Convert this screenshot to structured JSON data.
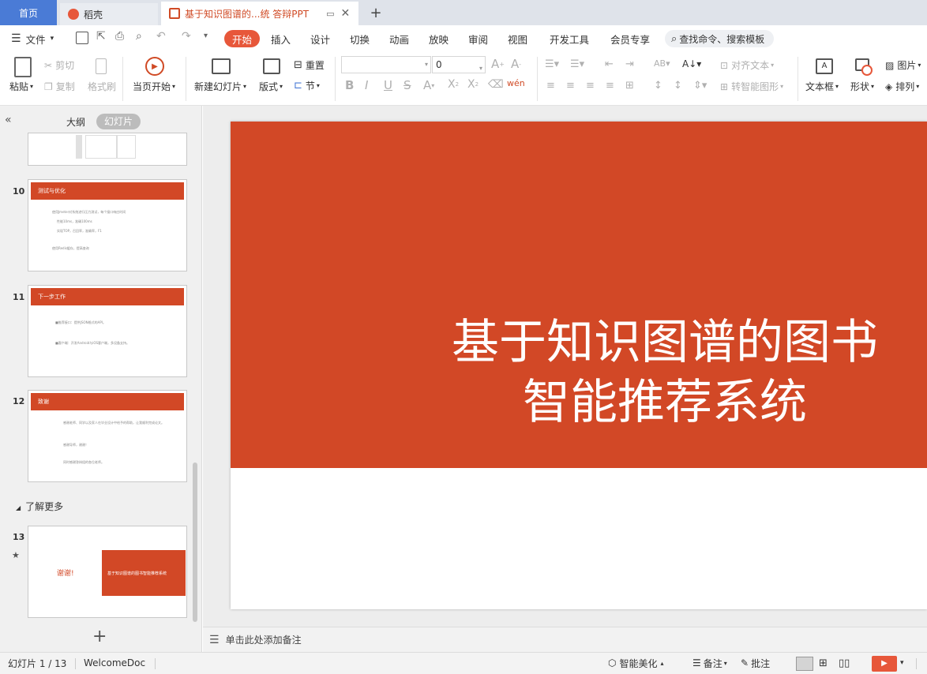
{
  "tabs": {
    "home": "首页",
    "doc": "稻壳",
    "active": "基于知识图谱的...统 答辩PPT"
  },
  "menu": [
    "文件",
    "开始",
    "插入",
    "设计",
    "切换",
    "动画",
    "放映",
    "审阅",
    "视图",
    "开发工具",
    "会员专享"
  ],
  "search_placeholder": "查找命令、搜索模板",
  "ribbon": {
    "paste": "粘贴",
    "cut": "剪切",
    "copy": "复制",
    "format_painter": "格式刷",
    "from_current": "当页开始",
    "new_slide": "新建幻灯片",
    "layout": "版式",
    "reset": "重置",
    "section": "节",
    "font_size": "0",
    "align_text": "对齐文本",
    "smartart": "转智能图形",
    "textbox": "文本框",
    "shapes": "形状",
    "picture": "图片",
    "arrange": "排列"
  },
  "panel": {
    "outline_tab": "大纲",
    "slides_tab": "幻灯片",
    "section_name": "了解更多"
  },
  "thumbs": [
    {
      "num": "10",
      "title": "测试与优化",
      "lines": [
        "使用Jmeter对系统进行压力测试，每个接口响应时间",
        "性能10ms，准确100ms",
        "实现TOP，召回率，准确率，F1",
        "使用Redis缓存，提高查询"
      ]
    },
    {
      "num": "11",
      "title": "下一步工作",
      "lines": [
        "■推荐接口：提供JSON格式的API。",
        "■客户端：开发Android与iOS客户端，多设备支持。"
      ]
    },
    {
      "num": "12",
      "title": "致谢",
      "lines": [
        "感谢老师、同学以及家人在毕业设计中给予的帮助，让我顺利完成论文。",
        "感谢导师，谢谢！",
        "同时感谢答辩组的各位老师。"
      ]
    },
    {
      "num": "13",
      "thanks": "谢谢!",
      "box": "基于知识图谱的图书智能推荐系统"
    }
  ],
  "slide": {
    "title_line1": "基于知识图谱的图书",
    "title_line2": "智能推荐系统"
  },
  "notes_placeholder": "单击此处添加备注",
  "status": {
    "slide_counter": "幻灯片 1 / 13",
    "theme": "WelcomeDoc",
    "beautify": "智能美化",
    "notes": "备注",
    "comments": "批注"
  },
  "colors": {
    "accent": "#d24826",
    "menu_active": "#e7573a",
    "home_tab": "#4a7bd6"
  }
}
